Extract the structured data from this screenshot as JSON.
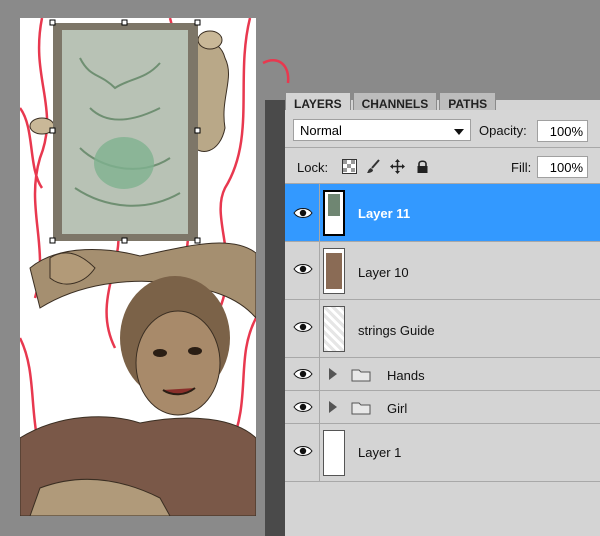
{
  "panel": {
    "tabs": [
      {
        "label": "LAYERS",
        "active": true
      },
      {
        "label": "CHANNELS",
        "active": false
      },
      {
        "label": "PATHS",
        "active": false
      }
    ],
    "blend_mode": "Normal",
    "opacity_label": "Opacity:",
    "opacity_value": "100%",
    "lock_label": "Lock:",
    "fill_label": "Fill:",
    "fill_value": "100%"
  },
  "layers": [
    {
      "name": "Layer 11",
      "selected": true,
      "kind": "layer"
    },
    {
      "name": "Layer 10",
      "selected": false,
      "kind": "layer"
    },
    {
      "name": "strings Guide",
      "selected": false,
      "kind": "layer"
    },
    {
      "name": "Hands",
      "selected": false,
      "kind": "group"
    },
    {
      "name": "Girl",
      "selected": false,
      "kind": "group"
    },
    {
      "name": "Layer 1",
      "selected": false,
      "kind": "layer"
    }
  ],
  "icons": {
    "visibility": "eye-icon",
    "lock_transparent": "checkerboard-lock-icon",
    "lock_image": "brush-lock-icon",
    "lock_position": "move-lock-icon",
    "lock_all": "padlock-icon",
    "expand": "triangle-expand-icon",
    "group": "folder-icon"
  },
  "colors": {
    "selection": "#3399ff",
    "panel_bg": "#d4d4d4",
    "string_red": "#e8384f"
  }
}
